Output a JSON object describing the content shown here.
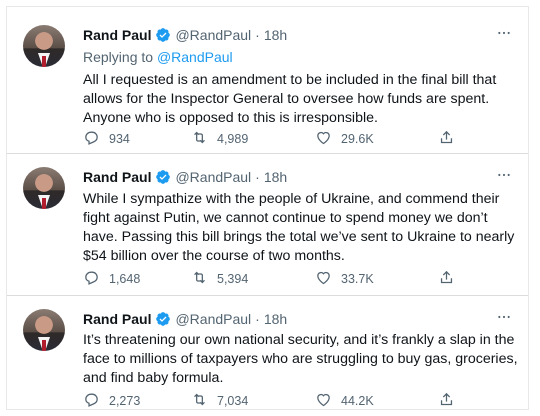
{
  "tweets": [
    {
      "author_name": "Rand Paul",
      "author_handle": "@RandPaul",
      "separator": "·",
      "time": "18h",
      "replying_prefix": "Replying to",
      "replying_to": "@RandPaul",
      "text": "All I requested is an amendment to be included in the final bill that allows for the Inspector General to oversee how funds are spent. Anyone who is opposed to this is irresponsible.",
      "replies": "934",
      "retweets": "4,989",
      "likes": "29.6K"
    },
    {
      "author_name": "Rand Paul",
      "author_handle": "@RandPaul",
      "separator": "·",
      "time": "18h",
      "text": "While I sympathize with the people of Ukraine, and commend their fight against Putin, we cannot continue to spend money we don’t have. Passing this bill brings the total we’ve sent to Ukraine to nearly $54 billion over the course of two months.",
      "replies": "1,648",
      "retweets": "5,394",
      "likes": "33.7K"
    },
    {
      "author_name": "Rand Paul",
      "author_handle": "@RandPaul",
      "separator": "·",
      "time": "18h",
      "text": "It’s threatening our own national security, and it’s frankly a slap in the face to millions of taxpayers who are struggling to buy gas, groceries, and find baby formula.",
      "replies": "2,273",
      "retweets": "7,034",
      "likes": "44.2K"
    }
  ],
  "icons": {
    "verified": "verified-badge-icon",
    "more": "more-icon",
    "reply": "reply-icon",
    "retweet": "retweet-icon",
    "like": "like-icon",
    "share": "share-icon"
  },
  "colors": {
    "link": "#1d9bf0",
    "secondary_text": "#536471",
    "primary_text": "#0f1419"
  }
}
